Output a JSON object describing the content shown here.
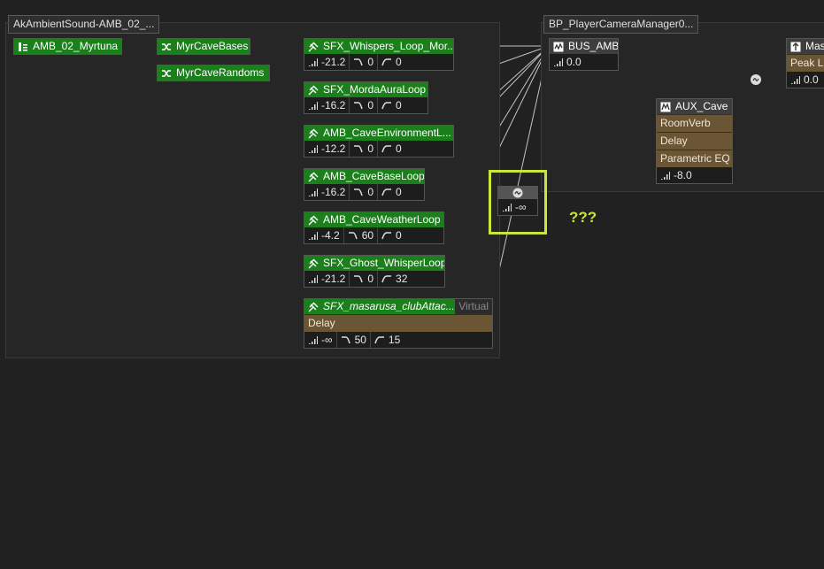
{
  "groups": {
    "ambient_title": "AkAmbientSound-AMB_02_...",
    "camera_title": "BP_PlayerCameraManager0..."
  },
  "source": {
    "label": "AMB_02_Myrtuna"
  },
  "containers": [
    {
      "label": "MyrCaveBases"
    },
    {
      "label": "MyrCaveRandoms"
    }
  ],
  "sounds": [
    {
      "label": "SFX_Whispers_Loop_Mor...",
      "volume": "-21.2",
      "lpf": "0",
      "hpf": "0"
    },
    {
      "label": "SFX_MordaAuraLoop",
      "volume": "-16.2",
      "lpf": "0",
      "hpf": "0"
    },
    {
      "label": "AMB_CaveEnvironmentL...",
      "volume": "-12.2",
      "lpf": "0",
      "hpf": "0"
    },
    {
      "label": "AMB_CaveBaseLoop",
      "volume": "-16.2",
      "lpf": "0",
      "hpf": "0"
    },
    {
      "label": "AMB_CaveWeatherLoop",
      "volume": "-4.2",
      "lpf": "60",
      "hpf": "0"
    },
    {
      "label": "SFX_Ghost_WhisperLoop",
      "volume": "-21.2",
      "lpf": "0",
      "hpf": "32"
    }
  ],
  "virtual_sound": {
    "label": "SFX_masarusa_clubAttac...",
    "badge": "Virtual",
    "effect": "Delay",
    "volume": "-∞",
    "lpf": "50",
    "hpf": "15"
  },
  "bus": {
    "label": "BUS_AMB",
    "volume": "0.0"
  },
  "aux": {
    "label": "AUX_Cave",
    "effects": [
      "RoomVerb",
      "Delay",
      "Parametric EQ"
    ],
    "volume": "-8.0"
  },
  "master": {
    "label": "Mas",
    "effect": "Peak Li",
    "volume": "0.0"
  },
  "send_node": {
    "volume": "-∞"
  },
  "annotation": {
    "text": "???"
  },
  "colors": {
    "node_green": "#1b7f1b",
    "effect_brown": "#6a5535",
    "highlight": "#c8e63c",
    "wire": "#c8c8c8"
  }
}
